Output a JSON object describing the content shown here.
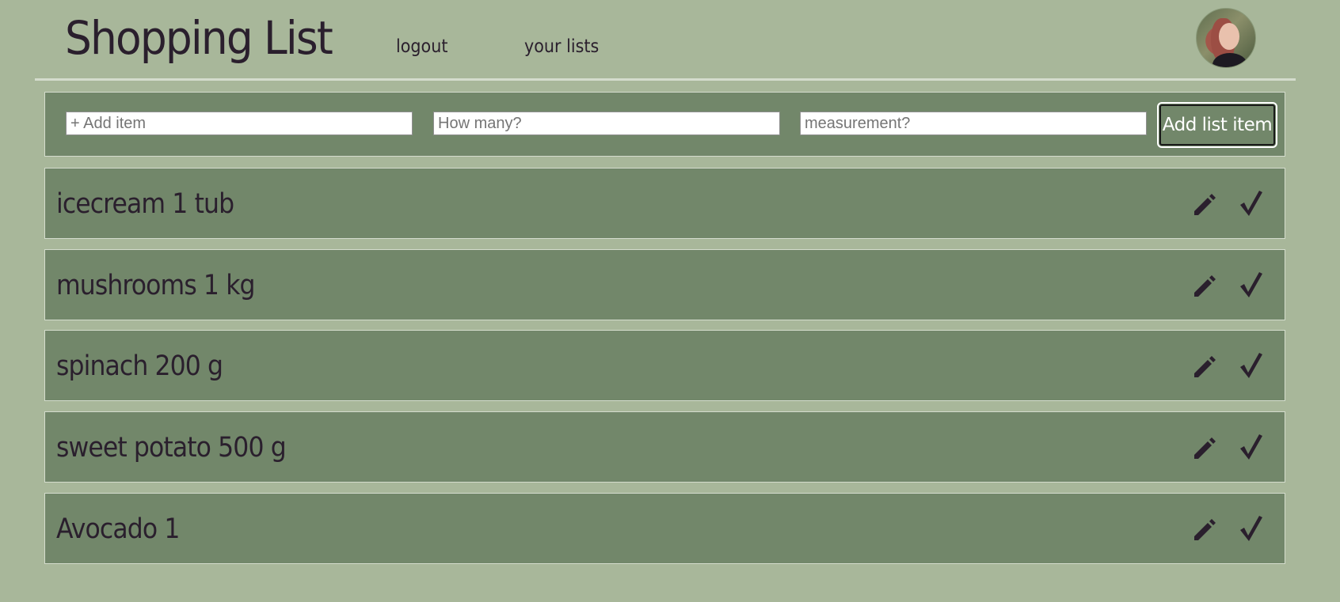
{
  "header": {
    "title": "Shopping List",
    "nav": {
      "logout": "logout",
      "your_lists": "your lists"
    },
    "avatar_icon": "user-avatar"
  },
  "add_form": {
    "item_placeholder": "+ Add item",
    "quantity_placeholder": "How many?",
    "measurement_placeholder": "measurement?",
    "submit_label": "Add list item"
  },
  "items": [
    {
      "label": "icecream 1 tub",
      "edit_icon": "pencil-icon",
      "done_icon": "check-icon"
    },
    {
      "label": "mushrooms 1 kg",
      "edit_icon": "pencil-icon",
      "done_icon": "check-icon"
    },
    {
      "label": "spinach 200 g",
      "edit_icon": "pencil-icon",
      "done_icon": "check-icon"
    },
    {
      "label": "sweet potato 500 g",
      "edit_icon": "pencil-icon",
      "done_icon": "check-icon"
    },
    {
      "label": "Avocado 1",
      "edit_icon": "pencil-icon",
      "done_icon": "check-icon"
    }
  ],
  "colors": {
    "background": "#a8b79a",
    "panel": "#72876a",
    "text": "#2a1f2d",
    "border": "#d4dccd"
  }
}
